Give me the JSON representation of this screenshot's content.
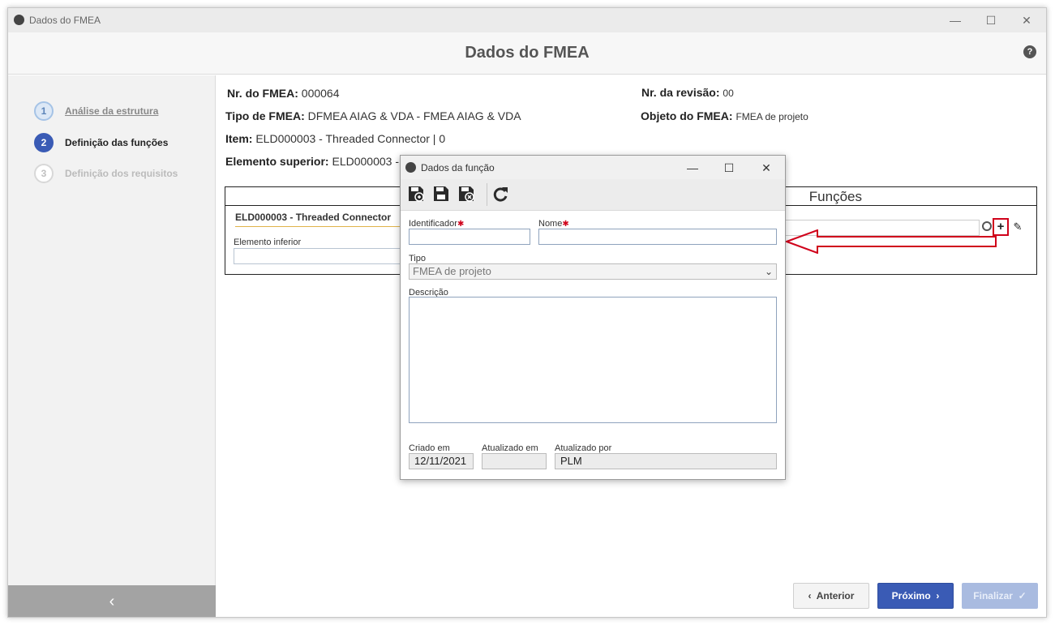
{
  "window": {
    "title": "Dados do FMEA"
  },
  "header": {
    "title": "Dados do FMEA",
    "help": "?"
  },
  "steps": [
    {
      "num": "1",
      "label": "Análise da estrutura"
    },
    {
      "num": "2",
      "label": "Definição das funções"
    },
    {
      "num": "3",
      "label": "Definição dos requisitos"
    }
  ],
  "sidebar": {
    "collapse_glyph": "‹"
  },
  "info": {
    "nr_fmea_label": "Nr. do FMEA:",
    "nr_fmea": "000064",
    "tipo_label": "Tipo de FMEA:",
    "tipo": "DFMEA AIAG & VDA - FMEA AIAG & VDA",
    "item_label": "Item:",
    "item": "ELD000003 - Threaded Connector | 0",
    "elem_sup_label": "Elemento superior:",
    "elem_sup": "ELD000003 -",
    "revisao_label": "Nr. da revisão:",
    "revisao": "00",
    "objeto_label": "Objeto do FMEA:",
    "objeto": "FMEA de projeto"
  },
  "panel": {
    "funcoes_title": "Funções",
    "element_title": "ELD000003 - Threaded Connector",
    "elemento_inferior_label": "Elemento inferior",
    "add_glyph": "+",
    "edit_glyph": "✎"
  },
  "dialog": {
    "title": "Dados da função",
    "identificador_label": "Identificador",
    "nome_label": "Nome",
    "required_mark": "✱",
    "tipo_label": "Tipo",
    "tipo_value": "FMEA de projeto",
    "descricao_label": "Descrição",
    "criado_label": "Criado em",
    "criado_value": "12/11/2021",
    "atualizado_em_label": "Atualizado em",
    "atualizado_em_value": "",
    "atualizado_por_label": "Atualizado por",
    "atualizado_por_value": "PLM"
  },
  "buttons": {
    "anterior": "Anterior",
    "proximo": "Próximo",
    "finalizar": "Finalizar"
  },
  "colors": {
    "primary": "#3a5bb5",
    "highlight": "#d0021b",
    "disabled": "#a9bbe0"
  }
}
